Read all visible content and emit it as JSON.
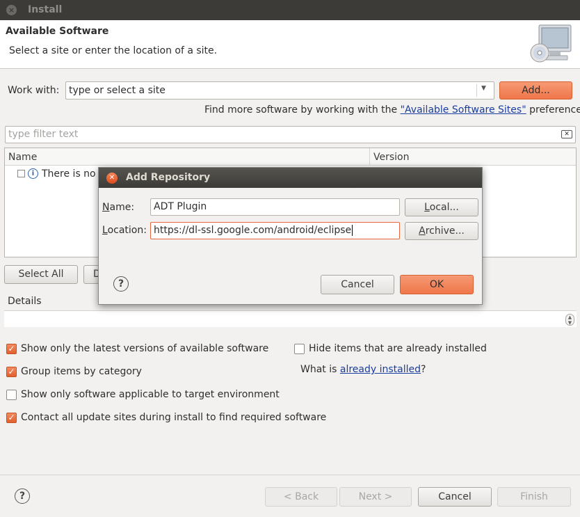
{
  "window": {
    "title": "Install"
  },
  "banner": {
    "title": "Available Software",
    "description": "Select a site or enter the location of a site."
  },
  "work_with": {
    "label": "Work with:",
    "combo_value": "type or select a site",
    "add_label": "Add...",
    "find_more_prefix": "Find more software by working with the ",
    "find_more_link": "\"Available Software Sites\"",
    "find_more_suffix": " preferences."
  },
  "filter": {
    "placeholder": "type filter text"
  },
  "table": {
    "columns": [
      "Name",
      "Version"
    ],
    "rows": [
      {
        "name": "There is no s"
      }
    ]
  },
  "selection": {
    "select_all": "Select All",
    "deselect_all": "D"
  },
  "details": {
    "label": "Details"
  },
  "options": [
    {
      "label": "Show only the latest versions of available software",
      "checked": true
    },
    {
      "label": "Group items by category",
      "checked": true
    },
    {
      "label": "Show only software applicable to target environment",
      "checked": false
    },
    {
      "label": "Contact all update sites during install to find required software",
      "checked": true
    },
    {
      "label": "Hide items that are already installed",
      "checked": false
    }
  ],
  "installed": {
    "prefix": "What is ",
    "link": "already installed",
    "suffix": "?"
  },
  "footer": {
    "back": "< Back",
    "next": "Next >",
    "cancel": "Cancel",
    "finish": "Finish"
  },
  "dialog": {
    "title": "Add Repository",
    "name_label_mn": "N",
    "name_label_rest": "ame:",
    "name_value": "ADT Plugin",
    "local_mn": "L",
    "local_rest": "ocal...",
    "location_label_mn": "L",
    "location_label_rest": "ocation:",
    "location_value": "https://dl-ssl.google.com/android/eclipse",
    "archive_mn": "A",
    "archive_rest": "rchive...",
    "cancel": "Cancel",
    "ok": "OK"
  },
  "colors": {
    "accent": "#ef7649",
    "link": "#1a3e9d",
    "titlebar": "#3c3b37"
  }
}
